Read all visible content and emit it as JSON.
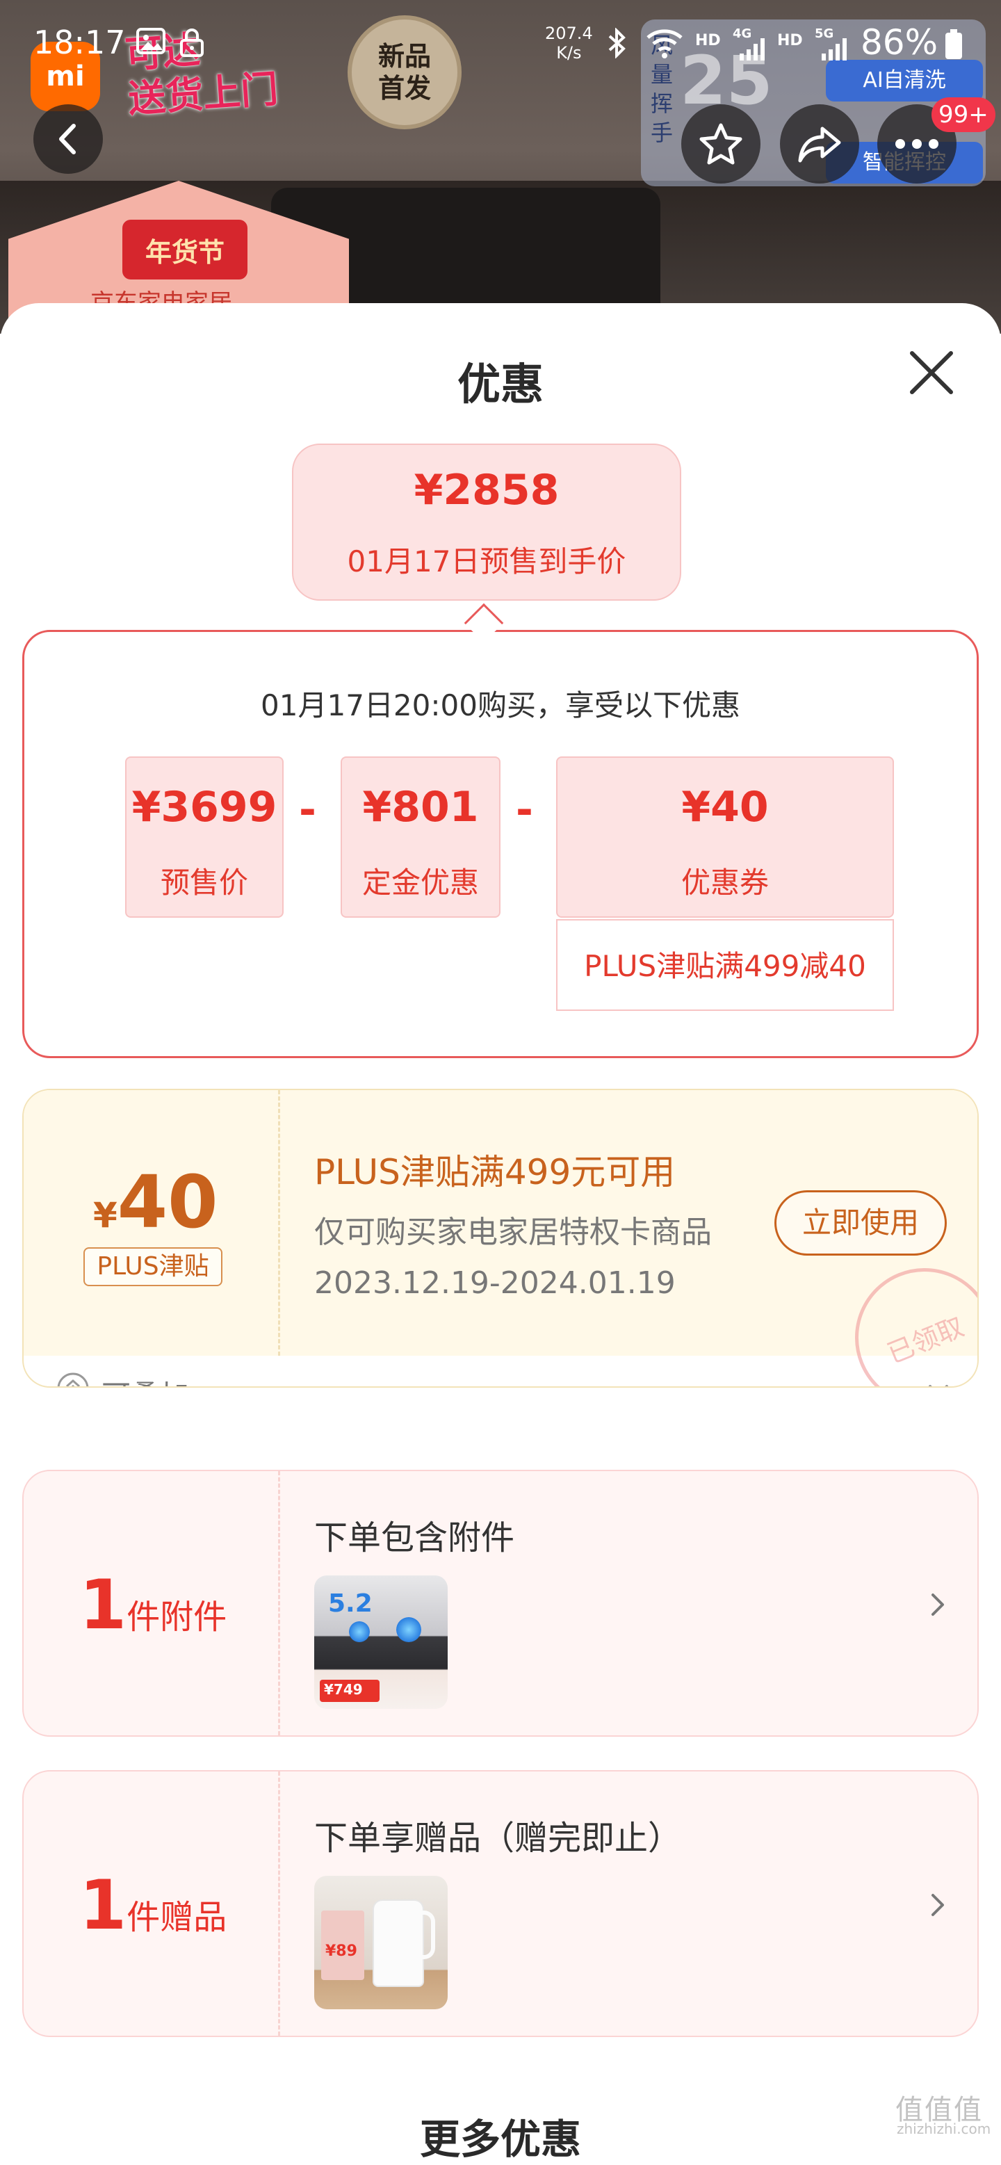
{
  "status_bar": {
    "time": "18:17",
    "net_speed_value": "207.4",
    "net_speed_unit": "K/s",
    "hd1": "HD",
    "net1": "4G",
    "hd2": "HD",
    "net2": "5G",
    "battery": "86%"
  },
  "background": {
    "logo_text": "mi",
    "banner_line1": "可达",
    "banner_line2": "送货上门",
    "stamp_line1": "新品",
    "stamp_line2": "首发",
    "house_tag": "年货节",
    "house_sub": "京东家电家居",
    "right_vertical": "风量",
    "right_vertical2": "挥手",
    "right_big": "25",
    "right_blue1": "AI自清洗",
    "right_blue2": "智能挥控"
  },
  "nav": {
    "badge": "99+"
  },
  "sheet": {
    "title": "优惠",
    "final_price": "¥2858",
    "final_price_caption": "01月17日预售到手价",
    "breakdown_heading": "01月17日20:00购买，享受以下优惠",
    "items": [
      {
        "value": "¥3699",
        "label": "预售价"
      },
      {
        "value": "¥801",
        "label": "定金优惠"
      },
      {
        "value": "¥40",
        "label": "优惠券"
      }
    ],
    "operators": [
      "-",
      "-"
    ],
    "coupon_source_note": "PLUS津贴满499减40",
    "coupon": {
      "currency": "¥",
      "amount": "40",
      "tag": "PLUS津贴",
      "title": "PLUS津贴满499元可用",
      "desc": "仅可购买家电家居特权卡商品",
      "date_range": "2023.12.19-2024.01.19",
      "use_button": "立即使用",
      "claimed_stamp": "已领取",
      "stackable_label": "可叠加"
    },
    "accessory": {
      "count": "1",
      "unit": "件附件",
      "title": "下单包含附件",
      "thumb_text": "5.2",
      "thumb_price": "¥749"
    },
    "gift": {
      "count": "1",
      "unit": "件赠品",
      "title": "下单享赠品（赠完即止）",
      "thumb_price": "¥89"
    },
    "more_title": "更多优惠"
  },
  "watermark": {
    "main": "值值值",
    "sub": "zhizhizhi.com"
  }
}
